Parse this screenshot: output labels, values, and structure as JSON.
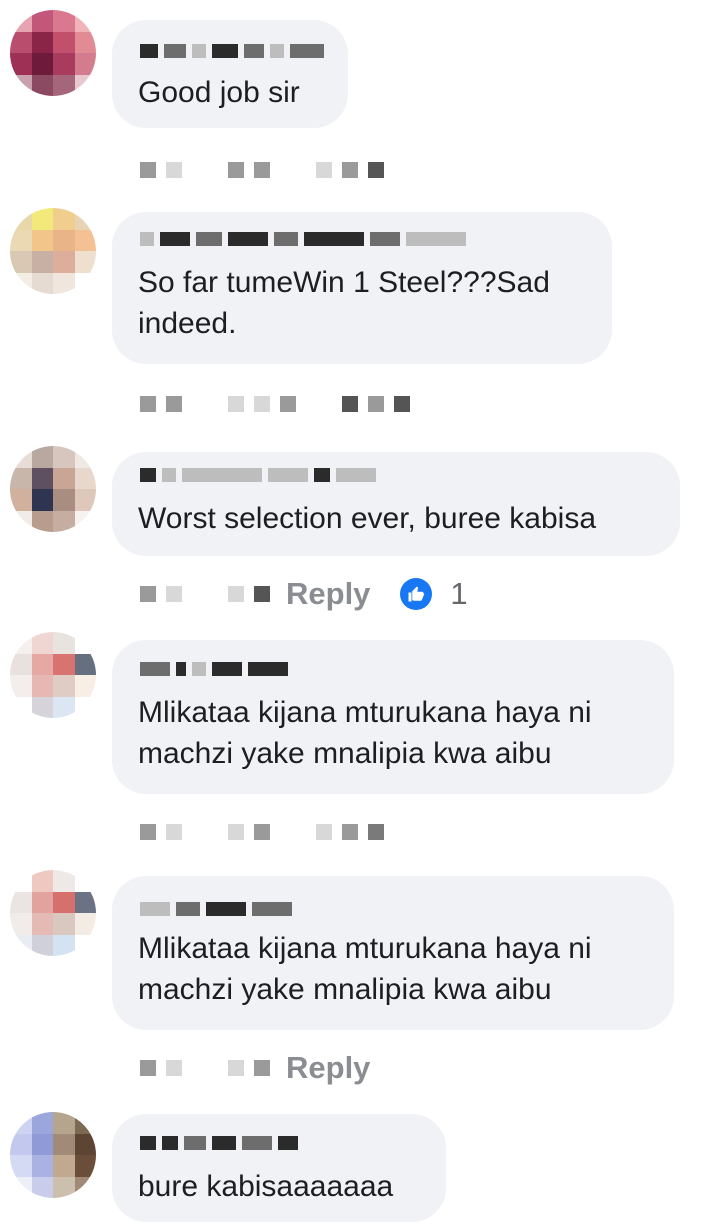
{
  "colors": {
    "bubble": "#f0f2f5",
    "text": "#1c1e21",
    "like_blue": "#1877f2",
    "meta_gray": "#8a8d91"
  },
  "comments": [
    {
      "text": "Good job sir"
    },
    {
      "text": "So far tumeWin 1 Steel???Sad indeed."
    },
    {
      "text": "Worst selection ever, buree kabisa",
      "reply_label": "Reply",
      "like_count": "1",
      "like_icon": "thumbs-up-icon"
    },
    {
      "text": "Mlikataa kijana mturukana haya ni machzi yake mnalipia kwa aibu"
    },
    {
      "text": "Mlikataa kijana mturukana haya ni machzi yake mnalipia kwa aibu",
      "reply_label": "Reply"
    },
    {
      "text": "bure kabisaaaaaaa"
    }
  ]
}
